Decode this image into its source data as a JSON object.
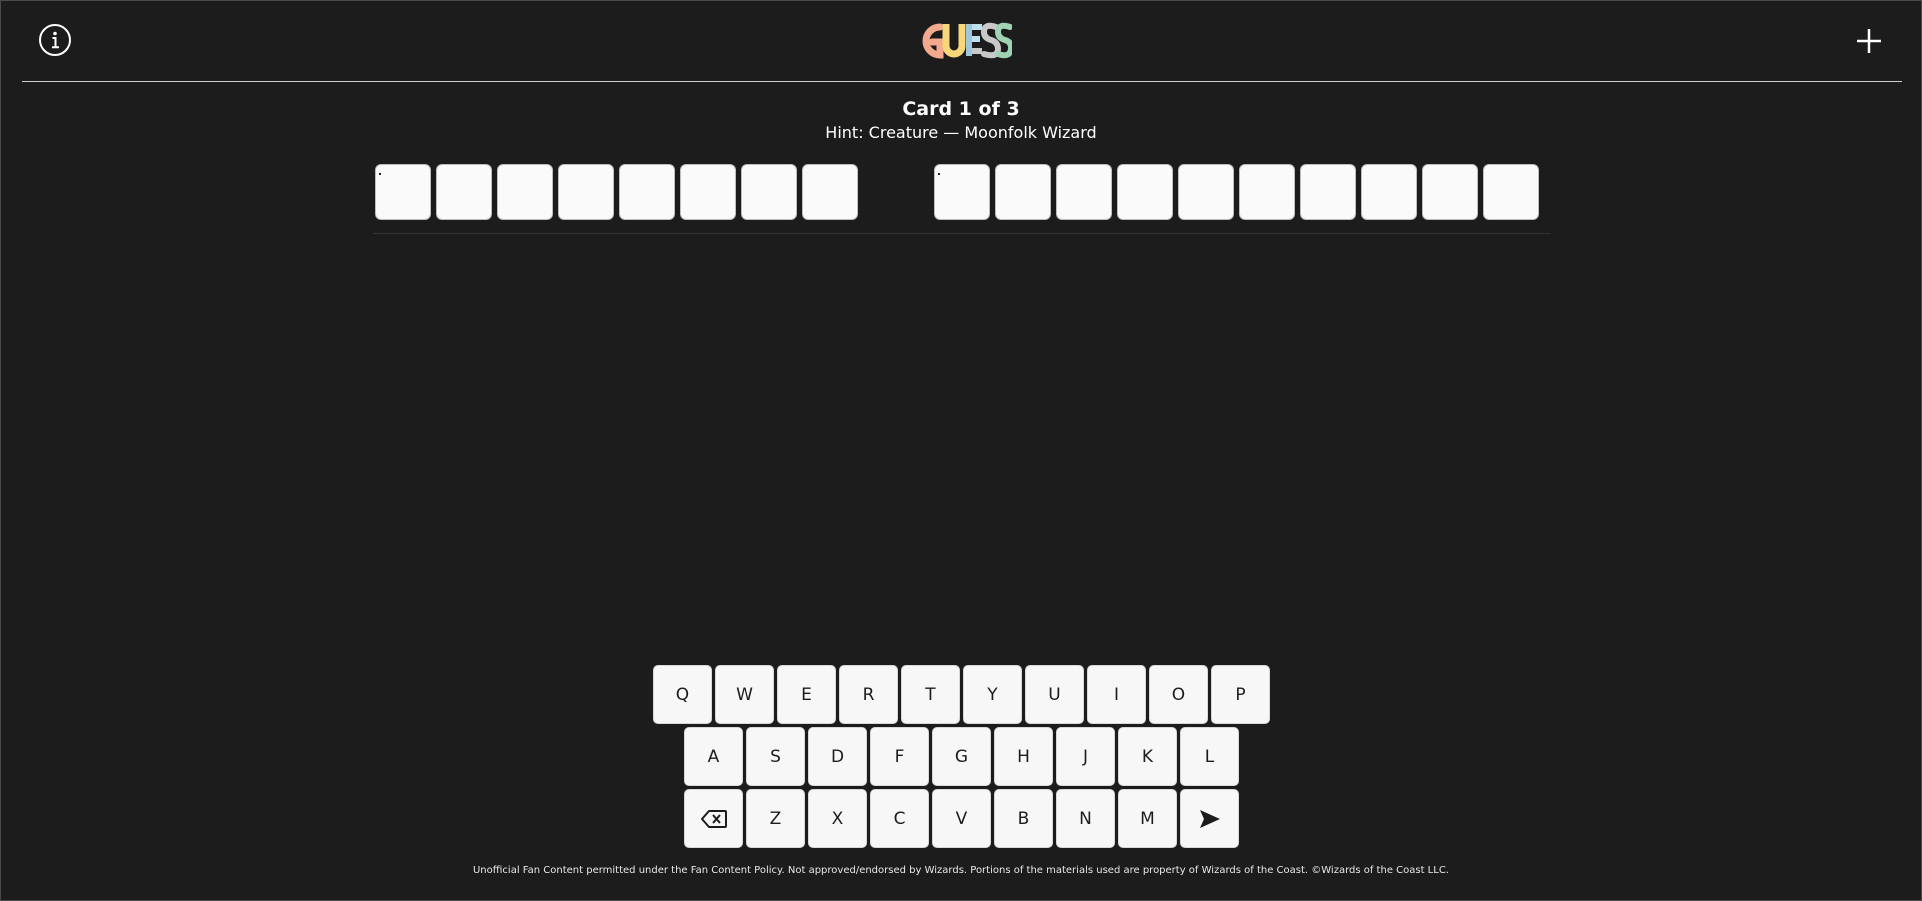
{
  "header": {
    "logo_text": "GUESS",
    "info_icon": "info-circle-icon",
    "new_icon": "plus-icon"
  },
  "puzzle": {
    "title": "Card 1 of 3",
    "hint": "Hint: Creature — Moonfolk Wizard",
    "word_lengths": [
      8,
      10
    ]
  },
  "keyboard": {
    "row1": [
      "Q",
      "W",
      "E",
      "R",
      "T",
      "Y",
      "U",
      "I",
      "O",
      "P"
    ],
    "row2": [
      "A",
      "S",
      "D",
      "F",
      "G",
      "H",
      "J",
      "K",
      "L"
    ],
    "row3": [
      "backspace",
      "Z",
      "X",
      "C",
      "V",
      "B",
      "N",
      "M",
      "enter"
    ],
    "backspace_icon": "backspace-icon",
    "enter_icon": "send-arrow-icon"
  },
  "footer": {
    "text": "Unofficial Fan Content permitted under the Fan Content Policy. Not approved/endorsed by Wizards. Portions of the materials used are property of Wizards of the Coast. ©Wizards of the Coast LLC."
  },
  "colors": {
    "background": "#1c1c1c",
    "tile": "#fafafa",
    "key": "#f7f7f7",
    "logo": [
      "#f2a98e",
      "#f7d77a",
      "#bfe0ef",
      "#c9c9c9",
      "#9fd3b3"
    ]
  }
}
